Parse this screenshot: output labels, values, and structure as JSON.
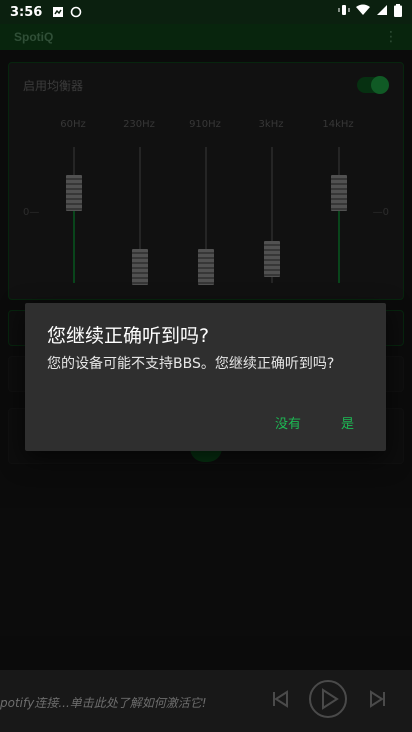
{
  "status_bar": {
    "time": "3:56"
  },
  "app_bar": {
    "title": "SpotiQ"
  },
  "equalizer": {
    "enable_label": "启用均衡器",
    "enabled": true,
    "min_label": "0—",
    "max_label": "—0",
    "bands": [
      {
        "freq": "60Hz",
        "level": 0.66
      },
      {
        "freq": "230Hz",
        "level": 0.12
      },
      {
        "freq": "910Hz",
        "level": 0.12
      },
      {
        "freq": "3kHz",
        "level": 0.18
      },
      {
        "freq": "14kHz",
        "level": 0.66
      }
    ]
  },
  "dialog": {
    "title": "您继续正确听到吗?",
    "message": "您的设备可能不支持BBS。您继续正确听到吗?",
    "no_label": "没有",
    "yes_label": "是"
  },
  "player": {
    "message": "potify连接...单击此处了解如何激活它!"
  },
  "colors": {
    "accent": "#1db954",
    "app_bar": "#0d3915"
  }
}
